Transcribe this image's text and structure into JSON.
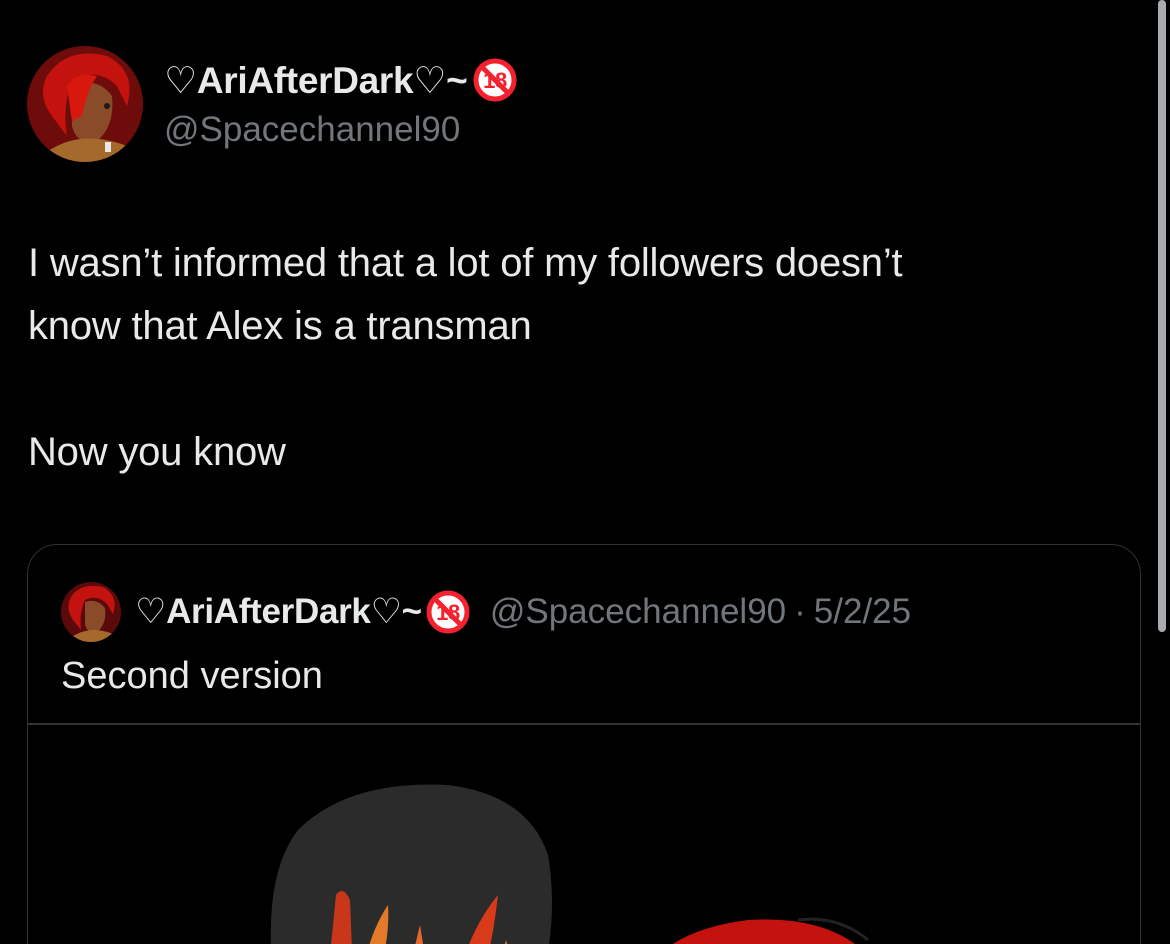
{
  "tweet": {
    "author": {
      "display_name": "♡AriAfterDark♡~",
      "badge_text": "18",
      "handle": "@Spacechannel90",
      "avatar": "avatar-image"
    },
    "text_lines": [
      "I wasn’t informed that a lot of my followers doesn’t",
      "know that Alex is a transman"
    ],
    "text_line_3": "Now you know"
  },
  "quoted_tweet": {
    "author": {
      "display_name": "♡AriAfterDark♡~",
      "badge_text": "18",
      "handle": "@Spacechannel90"
    },
    "separator": "·",
    "date": "5/2/25",
    "text": "Second version",
    "media": "artwork-image"
  },
  "colors": {
    "background": "#000000",
    "primary_text": "#e7e9ea",
    "secondary_text": "#71767b",
    "border": "#2f3336",
    "badge_red": "#f4212e"
  }
}
